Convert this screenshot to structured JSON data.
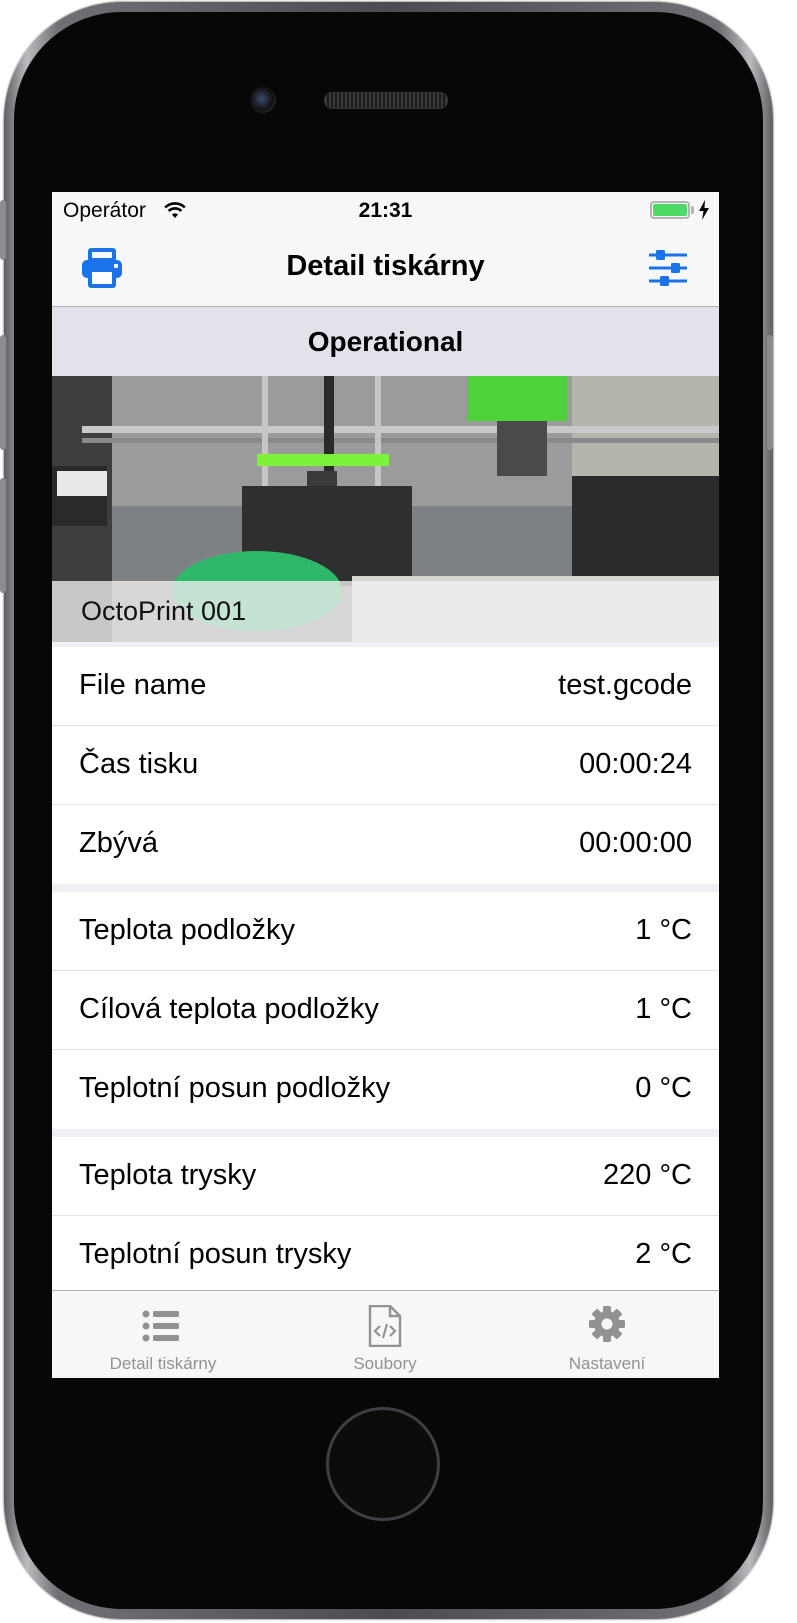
{
  "status_bar": {
    "carrier": "Operátor",
    "time": "21:31",
    "battery_color": "#4cd964"
  },
  "nav": {
    "title": "Detail tiskárny",
    "left_icon": "printer-icon",
    "right_icon": "sliders-icon",
    "accent_color": "#1a73e8"
  },
  "printer_state": "Operational",
  "webcam": {
    "printer_name": "OctoPrint 001"
  },
  "sections": [
    {
      "rows": [
        {
          "label": "File name",
          "value": "test.gcode"
        },
        {
          "label": "Čas tisku",
          "value": "00:00:24"
        },
        {
          "label": "Zbývá",
          "value": "00:00:00"
        }
      ]
    },
    {
      "rows": [
        {
          "label": "Teplota podložky",
          "value": "1 °C"
        },
        {
          "label": "Cílová teplota podložky",
          "value": "1 °C"
        },
        {
          "label": "Teplotní posun podložky",
          "value": "0 °C"
        }
      ]
    },
    {
      "rows": [
        {
          "label": "Teplota trysky",
          "value": "220 °C"
        },
        {
          "label": "Teplotní posun trysky",
          "value": "2 °C"
        }
      ]
    }
  ],
  "tabs": [
    {
      "label": "Detail tiskárny",
      "icon": "list-icon"
    },
    {
      "label": "Soubory",
      "icon": "code-file-icon"
    },
    {
      "label": "Nastavení",
      "icon": "gear-icon"
    }
  ]
}
